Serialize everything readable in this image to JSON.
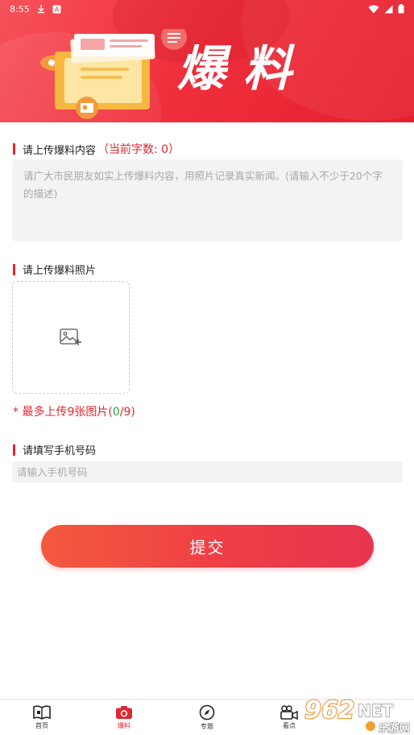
{
  "status_bar": {
    "time": "8:55",
    "icons": [
      "download-icon",
      "app-icon",
      "wifi-icon",
      "signal-icon",
      "battery-icon"
    ]
  },
  "banner": {
    "title": "爆料"
  },
  "content_section": {
    "label": "请上传爆料内容",
    "count_text": "（当前字数: 0）",
    "placeholder": "请广大市民朋友如实上传爆料内容，用照片记录真实新闻。(请输入不少于20个字的描述)"
  },
  "photo_section": {
    "label": "请上传爆料照片",
    "hint_prefix": "* 最多上传9张图片(",
    "hint_count": "0",
    "hint_suffix": "/9)",
    "upload_icon": "add-image-icon"
  },
  "phone_section": {
    "label": "请填写手机号码",
    "placeholder": "请输入手机号码"
  },
  "submit": {
    "label": "提交"
  },
  "tabbar": {
    "items": [
      {
        "label": "首页",
        "icon": "home-book-icon"
      },
      {
        "label": "爆料",
        "icon": "camera-icon"
      },
      {
        "label": "专题",
        "icon": "compass-icon"
      },
      {
        "label": "看点",
        "icon": "video-camera-icon"
      }
    ],
    "active_index": 1
  },
  "watermark": {
    "brand": "962NET",
    "site": "乐游网"
  },
  "colors": {
    "accent": "#e3262f",
    "banner": "#ef2f3c",
    "count_green": "#2f9e3a"
  }
}
